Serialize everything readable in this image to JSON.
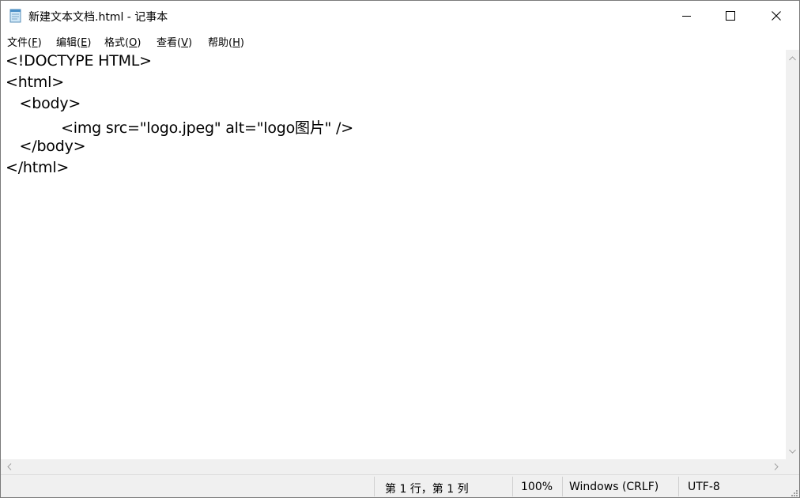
{
  "window": {
    "title": "新建文本文档.html - 记事本"
  },
  "menu": {
    "file": "文件",
    "file_key": "F",
    "edit": "编辑",
    "edit_key": "E",
    "format": "格式",
    "format_key": "O",
    "view": "查看",
    "view_key": "V",
    "help": "帮助",
    "help_key": "H"
  },
  "editor": {
    "lines": [
      "<!DOCTYPE HTML>",
      "<html>",
      "   <body>",
      "            <img src=\"logo.jpeg\" alt=\"logo图片\" />",
      "   </body>",
      "</html>"
    ]
  },
  "status": {
    "position": "第 1 行，第 1 列",
    "zoom": "100%",
    "line_ending": "Windows (CRLF)",
    "encoding": "UTF-8"
  },
  "icons": {
    "app": "notepad-icon",
    "minimize": "minimize-icon",
    "maximize": "maximize-icon",
    "close": "close-icon"
  }
}
